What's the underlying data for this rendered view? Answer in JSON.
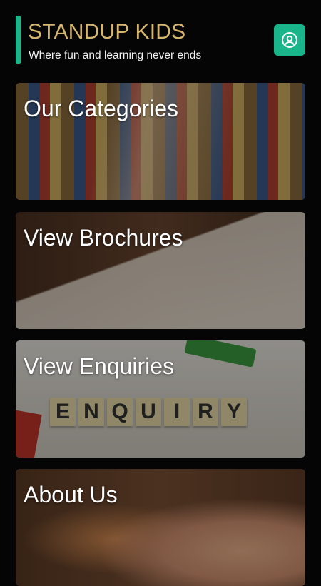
{
  "header": {
    "title": "STANDUP KIDS",
    "subtitle": "Where fun and learning never ends",
    "accent_color": "#1bb58c",
    "title_color": "#d6b66d",
    "profile_icon": "user-circle-icon"
  },
  "cards": [
    {
      "label": "Our Categories"
    },
    {
      "label": "View Brochures"
    },
    {
      "label": "View Enquiries",
      "tiles": [
        "E",
        "N",
        "Q",
        "U",
        "I",
        "R",
        "Y"
      ]
    },
    {
      "label": "About Us"
    }
  ]
}
